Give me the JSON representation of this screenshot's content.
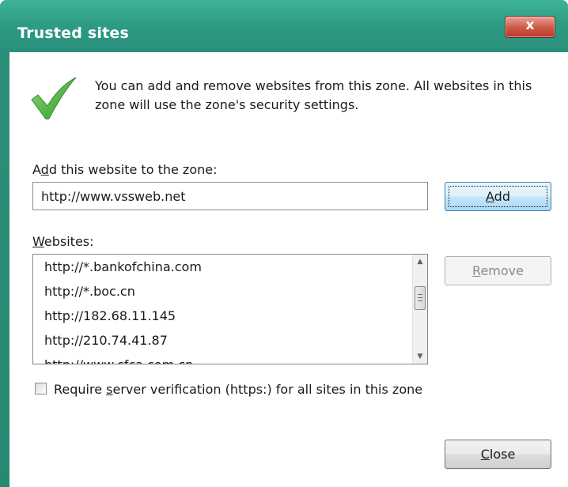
{
  "window": {
    "title": "Trusted sites",
    "close_glyph": "x"
  },
  "intro": {
    "icon": "checkmark-icon",
    "text": "You can add and remove websites from this zone. All websites in this zone will use the zone's security settings."
  },
  "add_section": {
    "label_pre": "A",
    "label_accel": "d",
    "label_post": "d this website to the zone:",
    "input_value": "http://www.vssweb.net",
    "add_accel": "A",
    "add_rest": "dd"
  },
  "websites": {
    "label_accel": "W",
    "label_rest": "ebsites:",
    "items": [
      "http://*.bankofchina.com",
      "http://*.boc.cn",
      "http://182.68.11.145",
      "http://210.74.41.87",
      "http://www.cfca.com.cn"
    ],
    "remove_accel": "R",
    "remove_rest": "emove"
  },
  "https_option": {
    "checked": false,
    "label_pre": "Require ",
    "label_accel": "s",
    "label_post": "erver verification (https:) for all sites in this zone"
  },
  "footer": {
    "close_accel": "C",
    "close_rest": "lose"
  },
  "colors": {
    "titlebar": "#2e9c85",
    "close_button": "#cf5d4a",
    "check_green": "#3cb43c"
  }
}
